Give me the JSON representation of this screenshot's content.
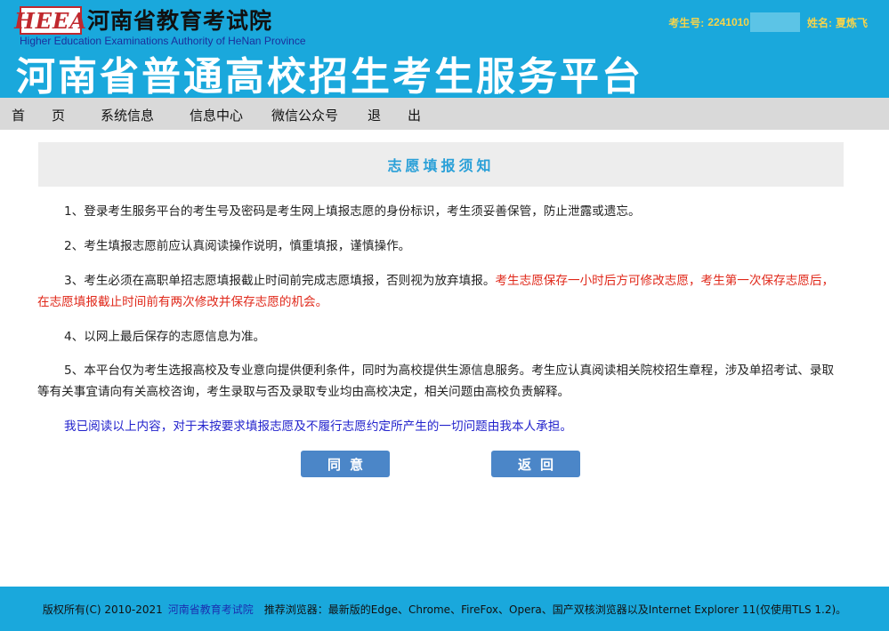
{
  "header": {
    "logo_text": "HEEA",
    "org_name": "河南省教育考试院",
    "org_name_en": "Higher Education Examinations Authority of HeNan Province",
    "platform_title": "河南省普通高校招生考生服务平台",
    "candidate_label": "考生号:",
    "candidate_no": "2241010",
    "name_label": "姓名:",
    "name_value": "夏炼飞"
  },
  "nav": {
    "items": [
      "首　　页",
      "系统信息",
      "信息中心",
      "微信公众号",
      "退　　出"
    ]
  },
  "notice": {
    "title": "志愿填报须知",
    "p1": "1、登录考生服务平台的考生号及密码是考生网上填报志愿的身份标识，考生须妥善保管，防止泄露或遗忘。",
    "p2": "2、考生填报志愿前应认真阅读操作说明，慎重填报，谨慎操作。",
    "p3_normal": "3、考生必须在高职单招志愿填报截止时间前完成志愿填报，否则视为放弃填报。",
    "p3_red": "考生志愿保存一小时后方可修改志愿，考生第一次保存志愿后，在志愿填报截止时间前有两次修改并保存志愿的机会。",
    "p4": "4、以网上最后保存的志愿信息为准。",
    "p5": "5、本平台仅为考生选报高校及专业意向提供便利条件，同时为高校提供生源信息服务。考生应认真阅读相关院校招生章程，涉及单招考试、录取等有关事宜请向有关高校咨询，考生录取与否及录取专业均由高校决定，相关问题由高校负责解释。",
    "declaration": "我已阅读以上内容，对于未按要求填报志愿及不履行志愿约定所产生的一切问题由我本人承担。"
  },
  "buttons": {
    "agree": "同意",
    "back": "返回"
  },
  "footer": {
    "copyright": "版权所有(C) 2010-2021",
    "org_link": "河南省教育考试院",
    "browsers": "推荐浏览器：最新版的Edge、Chrome、FireFox、Opera、国产双核浏览器以及Internet Explorer 11(仅使用TLS 1.2)。"
  },
  "colors": {
    "header_bg": "#1aa8dc",
    "nav_bg": "#d9d9d9",
    "title_color": "#2aa0d8",
    "warning_red": "#e0281a",
    "declaration_blue": "#2222cc",
    "button_bg": "#4b86c8",
    "user_info_yellow": "#f7d44a"
  }
}
